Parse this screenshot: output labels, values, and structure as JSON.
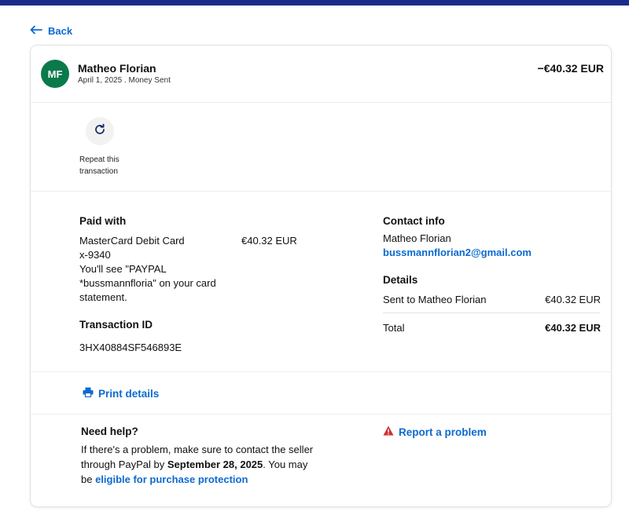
{
  "nav": {
    "back_label": "Back"
  },
  "transaction": {
    "avatar_initials": "MF",
    "name": "Matheo Florian",
    "subtitle": "April 1, 2025 . Money Sent",
    "amount": "−€40.32 EUR"
  },
  "repeat": {
    "label": "Repeat this transaction"
  },
  "paid_with": {
    "heading": "Paid with",
    "card_name": "MasterCard Debit Card",
    "card_number": "x-9340",
    "card_amount": "€40.32 EUR",
    "statement_note": "You'll see \"PAYPAL *bussmannfloria\" on your card statement."
  },
  "transaction_id": {
    "heading": "Transaction ID",
    "value": "3HX40884SF546893E"
  },
  "contact": {
    "heading": "Contact info",
    "name": "Matheo Florian",
    "email": "bussmannflorian2@gmail.com"
  },
  "details": {
    "heading": "Details",
    "sent_to_label": "Sent to Matheo Florian",
    "sent_to_amount": "€40.32 EUR",
    "total_label": "Total",
    "total_amount": "€40.32 EUR"
  },
  "print": {
    "label": "Print details"
  },
  "help": {
    "heading": "Need help?",
    "text_1": "If there's a problem, make sure to contact the seller through PayPal by ",
    "deadline": "September 28, 2025",
    "text_2": ". You may be ",
    "link": "eligible for purchase protection",
    "report_label": "Report a problem"
  },
  "colors": {
    "top_bar": "#1a2a8a",
    "link_blue": "#0b6ad0",
    "avatar_green": "#0b7a4a",
    "warning_red": "#d32f2f"
  },
  "icons": [
    "arrow-left-icon",
    "refresh-icon",
    "printer-icon",
    "warning-icon"
  ]
}
